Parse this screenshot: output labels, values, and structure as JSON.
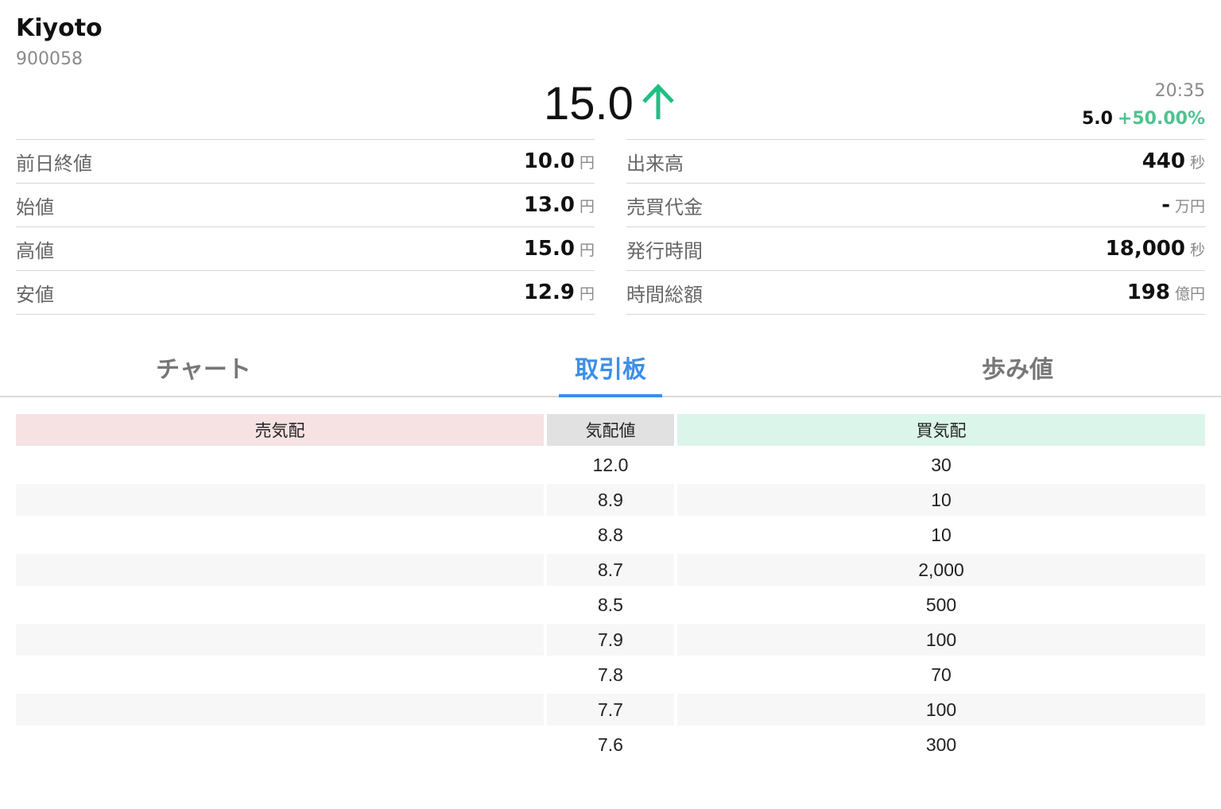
{
  "stock": {
    "name": "Kiyoto",
    "code": "900058"
  },
  "price": {
    "current": "15.0",
    "direction": "up",
    "time": "20:35",
    "change_amount": "5.0",
    "change_percent": "+50.00%",
    "up_color": "#1ebf83"
  },
  "stats_left": [
    {
      "label": "前日終値",
      "value": "10.0",
      "unit": "円"
    },
    {
      "label": "始値",
      "value": "13.0",
      "unit": "円"
    },
    {
      "label": "高値",
      "value": "15.0",
      "unit": "円"
    },
    {
      "label": "安値",
      "value": "12.9",
      "unit": "円"
    }
  ],
  "stats_right": [
    {
      "label": "出来高",
      "value": "440",
      "unit": "秒"
    },
    {
      "label": "売買代金",
      "value": "-",
      "unit": "万円"
    },
    {
      "label": "発行時間",
      "value": "18,000",
      "unit": "秒"
    },
    {
      "label": "時間総額",
      "value": "198",
      "unit": "億円"
    }
  ],
  "tabs": [
    {
      "label": "チャート",
      "active": false
    },
    {
      "label": "取引板",
      "active": true
    },
    {
      "label": "歩み値",
      "active": false
    }
  ],
  "order_book": {
    "headers": {
      "sell": "売気配",
      "price": "気配値",
      "buy": "買気配"
    },
    "rows": [
      {
        "sell": "",
        "price": "12.0",
        "buy": "30"
      },
      {
        "sell": "",
        "price": "8.9",
        "buy": "10"
      },
      {
        "sell": "",
        "price": "8.8",
        "buy": "10"
      },
      {
        "sell": "",
        "price": "8.7",
        "buy": "2,000"
      },
      {
        "sell": "",
        "price": "8.5",
        "buy": "500"
      },
      {
        "sell": "",
        "price": "7.9",
        "buy": "100"
      },
      {
        "sell": "",
        "price": "7.8",
        "buy": "70"
      },
      {
        "sell": "",
        "price": "7.7",
        "buy": "100"
      },
      {
        "sell": "",
        "price": "7.6",
        "buy": "300"
      }
    ]
  },
  "colors": {
    "accent": "#3d8ee6",
    "sell_header": "#f6e1e3",
    "buy_header": "#dbf5ea",
    "price_header": "#e1e1e1",
    "positive": "#4fc290"
  }
}
